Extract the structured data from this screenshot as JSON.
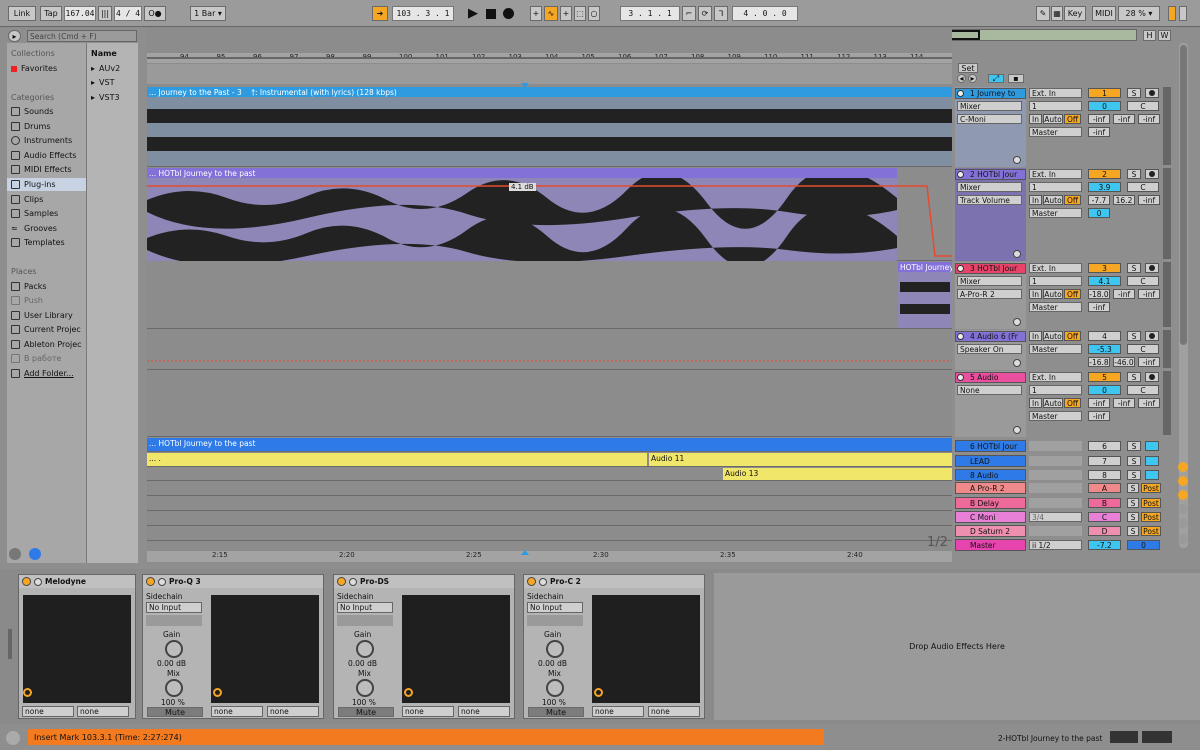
{
  "topbar": {
    "link": "Link",
    "tap": "Tap",
    "tempo": "167.04",
    "bars_glyph": "|||",
    "signature": "4 / 4",
    "metro": "O●",
    "quantize": "1 Bar",
    "position": "103 .  3 .  1",
    "loop_start": "3 .  1 .  1",
    "loop_len": "4 .  0 .  0",
    "key": "Key",
    "midi": "MIDI",
    "cpu": "28 %",
    "hw_h": "H",
    "hw_w": "W"
  },
  "browser": {
    "search_placeholder": "Search (Cmd + F)",
    "collections_header": "Collections",
    "favorites": "Favorites",
    "categories_header": "Categories",
    "categories": [
      "Sounds",
      "Drums",
      "Instruments",
      "Audio Effects",
      "MIDI Effects",
      "Plug-ins",
      "Clips",
      "Samples",
      "Grooves",
      "Templates"
    ],
    "places_header": "Places",
    "places": [
      "Packs",
      "Push",
      "User Library",
      "Current Projec",
      "Ableton Projec",
      "В работе",
      "Add Folder..."
    ],
    "name_header": "Name",
    "names": [
      "AUv2",
      "VST",
      "VST3"
    ]
  },
  "ruler": {
    "bars": [
      "94",
      "95",
      "96",
      "97",
      "98",
      "99",
      "100",
      "101",
      "102",
      "103",
      "104",
      "105",
      "106",
      "107",
      "108",
      "109",
      "110",
      "111",
      "112",
      "113",
      "114"
    ],
    "times": [
      "2:15",
      "2:20",
      "2:25",
      "2:30",
      "2:35",
      "2:40"
    ],
    "set_label": "Set",
    "page_indicator": "1/2"
  },
  "clips": {
    "c1": "... Journey to the Past - 3",
    "c1b": "†: Instrumental (with lyrics) (128 kbps)",
    "c2": "... HOTbl Journey to the past",
    "c2_vol": "4.1 dB",
    "c3": "HOTbl Journey",
    "c6": "... HOTbl Journey to the past",
    "lead": "... .",
    "lead2": "Audio 11",
    "audio13": "Audio 13"
  },
  "tracks": [
    {
      "name": "1 Journey to",
      "color": "#2e9be0",
      "dev": "Mixer",
      "param": "C-Moni",
      "input": "Ext. In",
      "chan": "1",
      "monitor": "In",
      "auto": "Auto",
      "off": "Off",
      "out": "Master",
      "num": "1",
      "vol": "0",
      "pan": "C",
      "sendA": "-inf",
      "sendB": "-inf",
      "sendC": "-inf",
      "sendD": "-inf"
    },
    {
      "name": "2 HOTbl Jour",
      "color": "#8471d8",
      "dev": "Mixer",
      "param": "Track Volume",
      "input": "Ext. In",
      "chan": "1",
      "monitor": "In",
      "auto": "Auto",
      "off": "Off",
      "out": "Master",
      "num": "2",
      "vol": "3.9",
      "pan": "C",
      "sendA": "-7.7",
      "sendB": "16.2",
      "sendC": "-inf",
      "sendD": "0"
    },
    {
      "name": "3 HOTbl Jour",
      "color": "#e8446a",
      "dev": "Mixer",
      "param": "A-Pro-R 2",
      "input": "Ext. In",
      "chan": "1",
      "monitor": "In",
      "auto": "Auto",
      "off": "Off",
      "out": "Master",
      "num": "3",
      "vol": "4.1",
      "pan": "C",
      "sendA": "-18.0",
      "sendB": "-inf",
      "sendC": "-inf",
      "sendD": "-inf"
    },
    {
      "name": "4 Audio 6 (Fr",
      "color": "#8471d8",
      "dev": "Speaker On",
      "param": "",
      "input": "",
      "chan": "",
      "monitor": "In",
      "auto": "Auto",
      "off": "Off",
      "out": "Master",
      "num": "4",
      "vol": "-5.3",
      "pan": "C",
      "sendA": "-16.8",
      "sendB": "-46.0",
      "sendC": "-inf",
      "sendD": ""
    },
    {
      "name": "5 Audio",
      "color": "#ea4fa0",
      "dev": "None",
      "param": "",
      "input": "Ext. In",
      "chan": "1",
      "monitor": "In",
      "auto": "Auto",
      "off": "Off",
      "out": "Master",
      "num": "5",
      "vol": "0",
      "pan": "C",
      "sendA": "-inf",
      "sendB": "-inf",
      "sendC": "-inf",
      "sendD": "-inf"
    }
  ],
  "groups": [
    {
      "name": "6 HOTbl Jour",
      "num": "6",
      "color": "#2e7be8"
    },
    {
      "name": "LEAD",
      "num": "7",
      "color": "#2e7be8"
    },
    {
      "name": "8 Audio",
      "num": "8",
      "color": "#2e7be8"
    }
  ],
  "returns": [
    {
      "name": "A Pro-R 2",
      "letter": "A",
      "color": "#f08a8a"
    },
    {
      "name": "B Delay",
      "letter": "B",
      "color": "#ee6a9a"
    },
    {
      "name": "C Moni",
      "letter": "C",
      "color": "#e880d8"
    },
    {
      "name": "D Saturn 2",
      "letter": "D",
      "color": "#ef8fb0"
    }
  ],
  "master": {
    "name": "Master",
    "route": "ii 1/2",
    "vol": "-7.2",
    "num": "0",
    "post": "Post",
    "send_c_chan": "3/4",
    "solo": "S"
  },
  "devices": {
    "melodyne": "Melodyne",
    "proq": "Pro-Q 3",
    "prods": "Pro-DS",
    "proc": "Pro-C 2",
    "sidechain": "Sidechain",
    "no_input": "No Input",
    "gain": "Gain",
    "gain_val": "0.00 dB",
    "mix": "Mix",
    "mix_val": "100 %",
    "mute": "Mute",
    "none": "none",
    "drop": "Drop Audio Effects Here"
  },
  "status": {
    "message": "Insert Mark 103.3.1 (Time: 2:27:274)",
    "track": "2-HOTbl Journey to the past"
  }
}
